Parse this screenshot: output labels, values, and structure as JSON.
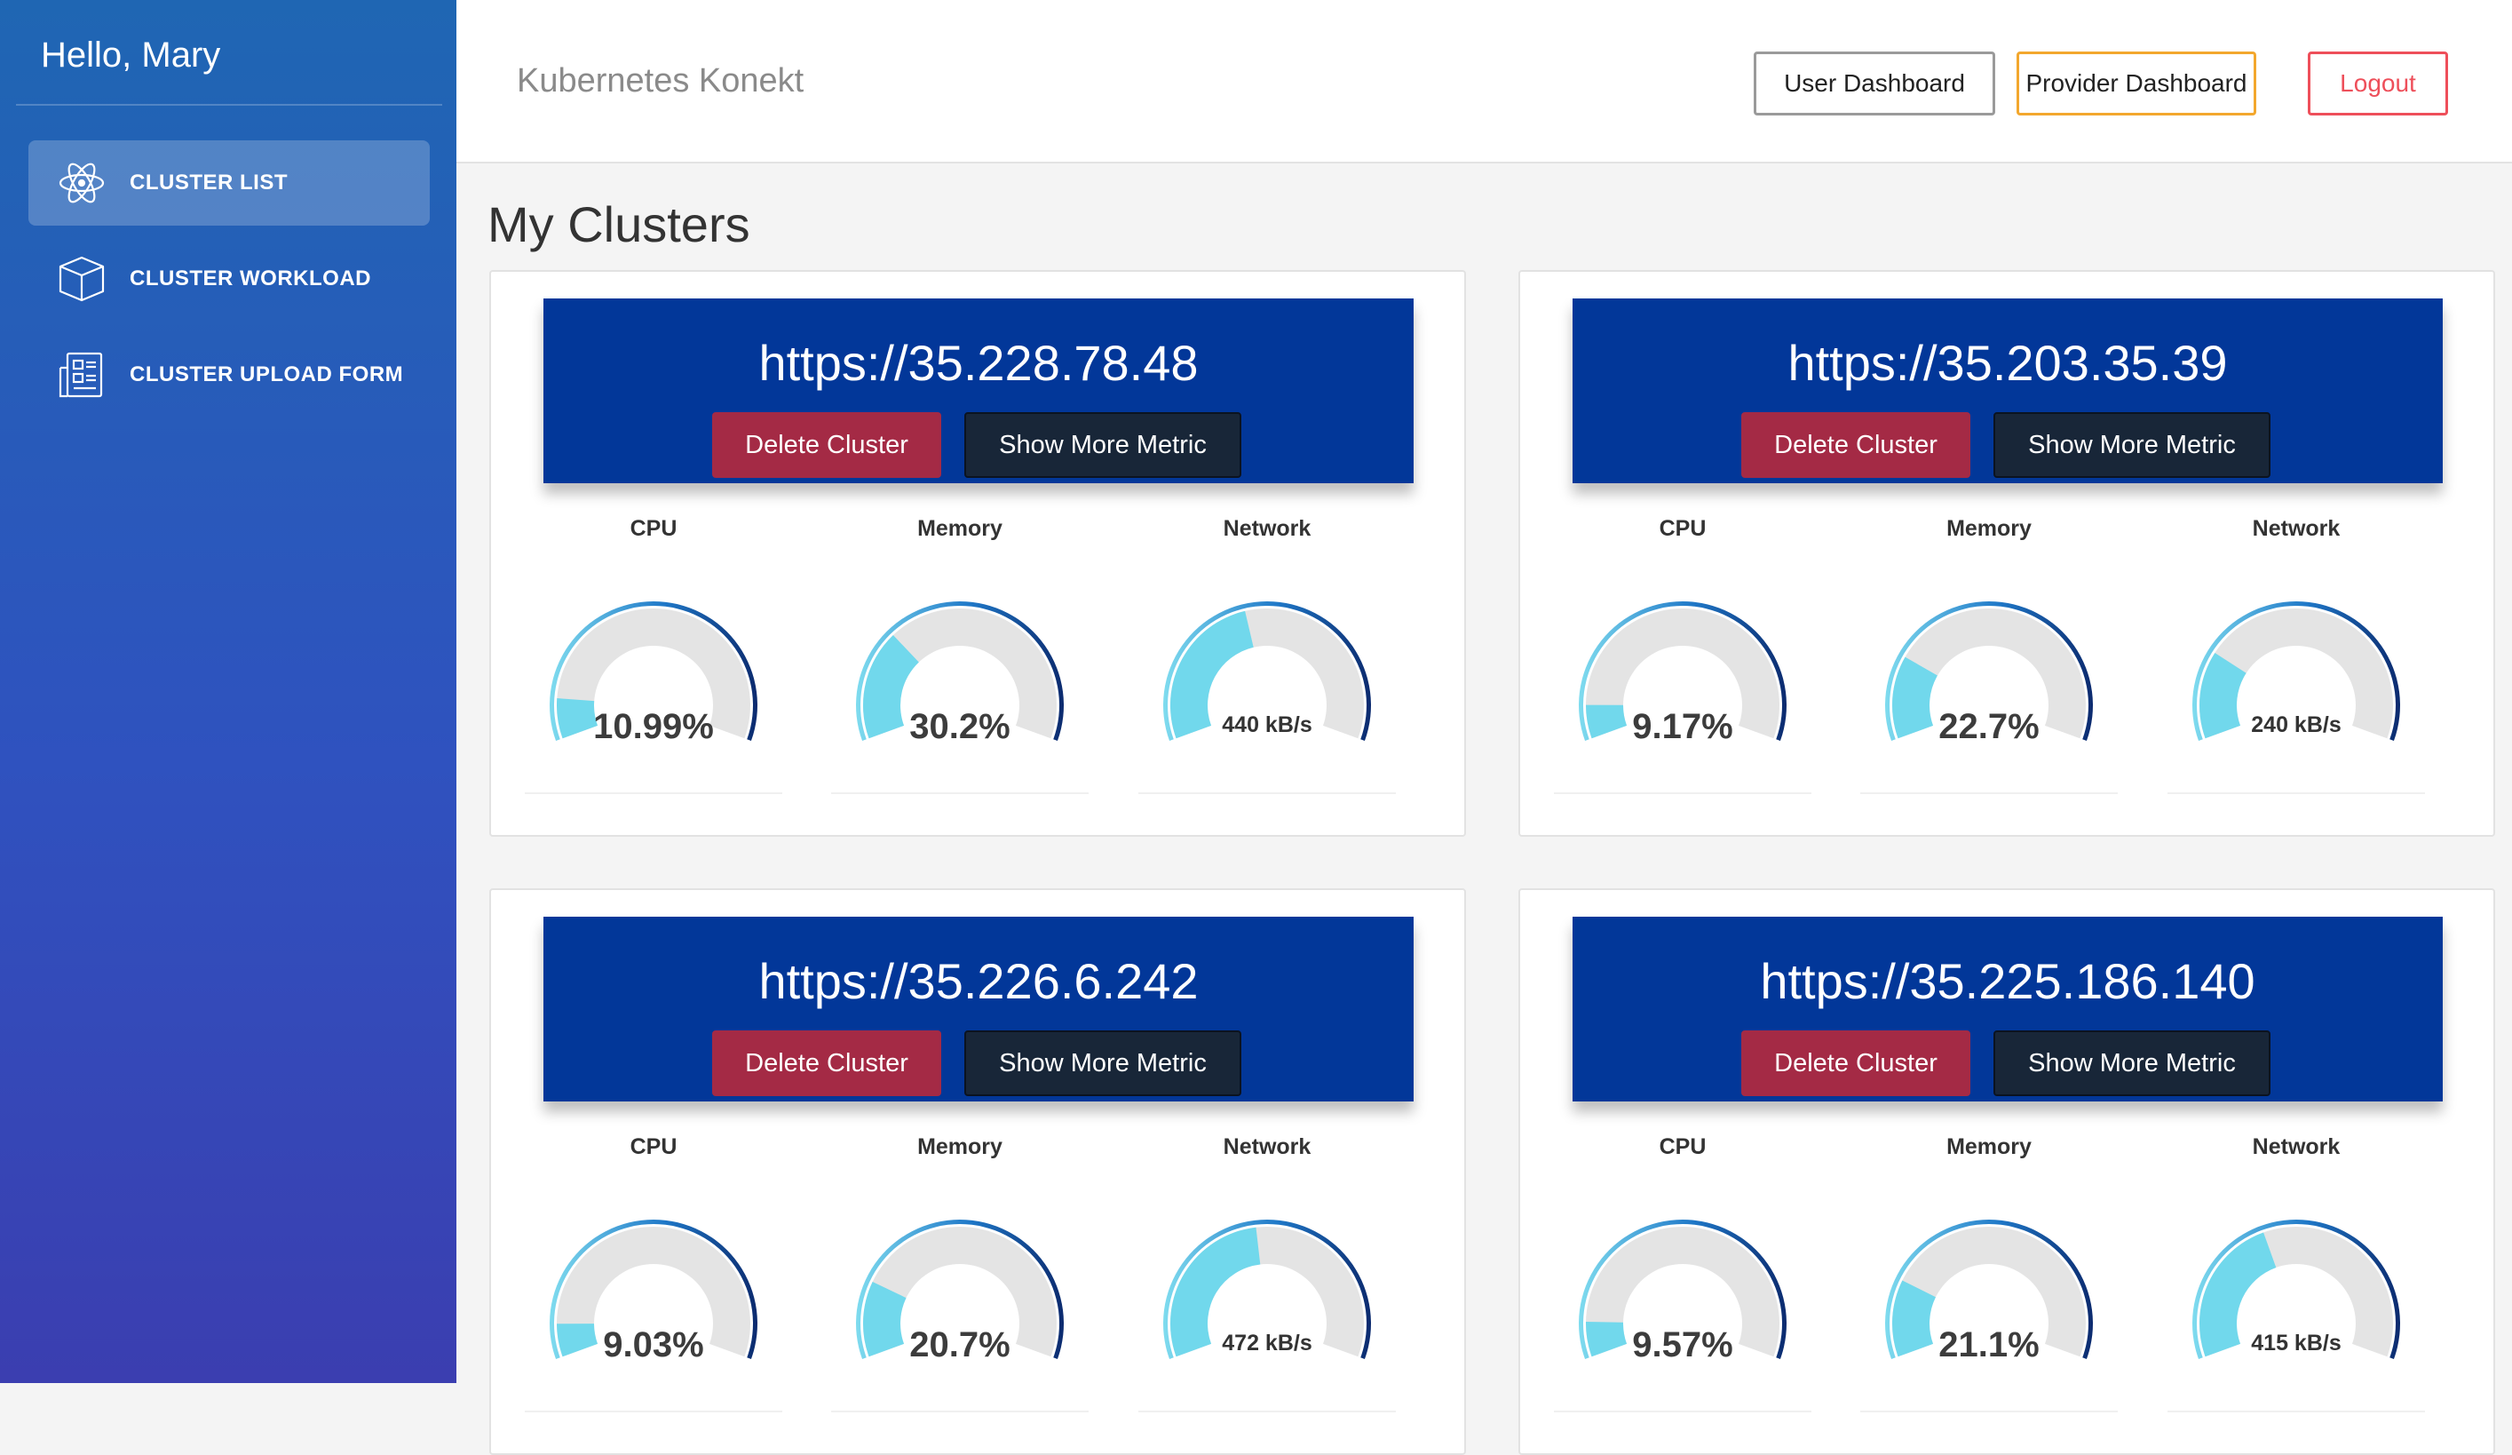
{
  "sidebar": {
    "greeting": "Hello, Mary",
    "items": [
      {
        "label": "CLUSTER LIST",
        "icon": "atom-icon",
        "active": true
      },
      {
        "label": "CLUSTER WORKLOAD",
        "icon": "cube-icon",
        "active": false
      },
      {
        "label": "CLUSTER UPLOAD FORM",
        "icon": "form-icon",
        "active": false
      }
    ]
  },
  "topbar": {
    "brand": "Kubernetes Konekt",
    "user_dashboard": "User Dashboard",
    "provider_dashboard": "Provider Dashboard",
    "logout": "Logout"
  },
  "main": {
    "title": "My Clusters",
    "delete_label": "Delete Cluster",
    "metric_label": "Show More Metric",
    "gauge_titles": {
      "cpu": "CPU",
      "memory": "Memory",
      "network": "Network"
    },
    "clusters": [
      {
        "url": "https://35.228.78.48",
        "cpu": {
          "value": 10.99,
          "text": "10.99%"
        },
        "memory": {
          "value": 30.2,
          "text": "30.2%"
        },
        "network": {
          "fraction": 0.44,
          "text": "440 kB/s"
        }
      },
      {
        "url": "https://35.203.35.39",
        "cpu": {
          "value": 9.17,
          "text": "9.17%"
        },
        "memory": {
          "value": 22.7,
          "text": "22.7%"
        },
        "network": {
          "fraction": 0.24,
          "text": "240 kB/s"
        }
      },
      {
        "url": "https://35.226.6.242",
        "cpu": {
          "value": 9.03,
          "text": "9.03%"
        },
        "memory": {
          "value": 20.7,
          "text": "20.7%"
        },
        "network": {
          "fraction": 0.47,
          "text": "472 kB/s"
        }
      },
      {
        "url": "https://35.225.186.140",
        "cpu": {
          "value": 9.57,
          "text": "9.57%"
        },
        "memory": {
          "value": 21.1,
          "text": "21.1%"
        },
        "network": {
          "fraction": 0.41,
          "text": "415 kB/s"
        }
      }
    ]
  },
  "colors": {
    "header_bg": "#023799",
    "gauge_fill": "#71d8ec",
    "gauge_track": "#e4e4e4",
    "delete_bg": "#a42a45",
    "metric_bg": "#182638"
  }
}
